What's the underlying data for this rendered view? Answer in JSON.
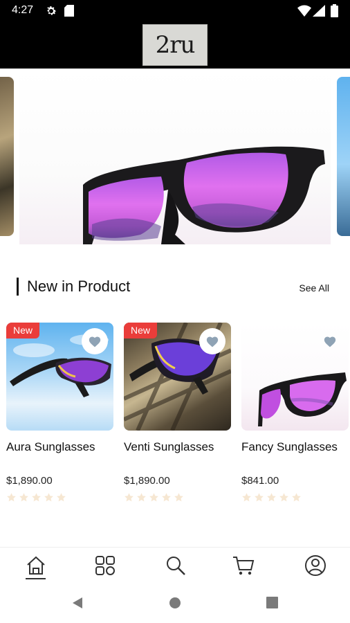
{
  "status_bar": {
    "time": "4:27"
  },
  "header": {
    "logo_text": "2ru"
  },
  "section": {
    "title": "New in Product",
    "see_all": "See All"
  },
  "products": [
    {
      "name": "Aura Sunglasses",
      "price": "$1,890.00",
      "badge": "New",
      "rating": 0,
      "favorite_icon": "heart-icon"
    },
    {
      "name": "Venti Sunglasses",
      "price": "$1,890.00",
      "badge": "New",
      "rating": 0,
      "favorite_icon": "heart-icon"
    },
    {
      "name": "Fancy Sunglasses",
      "price": "$841.00",
      "badge": "",
      "rating": 0,
      "favorite_icon": "heart-icon"
    }
  ],
  "bottom_nav": {
    "items": [
      "home-icon",
      "categories-icon",
      "search-icon",
      "cart-icon",
      "profile-icon"
    ],
    "active": "home-icon"
  },
  "colors": {
    "badge": "#ea3d3a",
    "star": "#f6e7d2",
    "heart": "#8fa3b5"
  }
}
